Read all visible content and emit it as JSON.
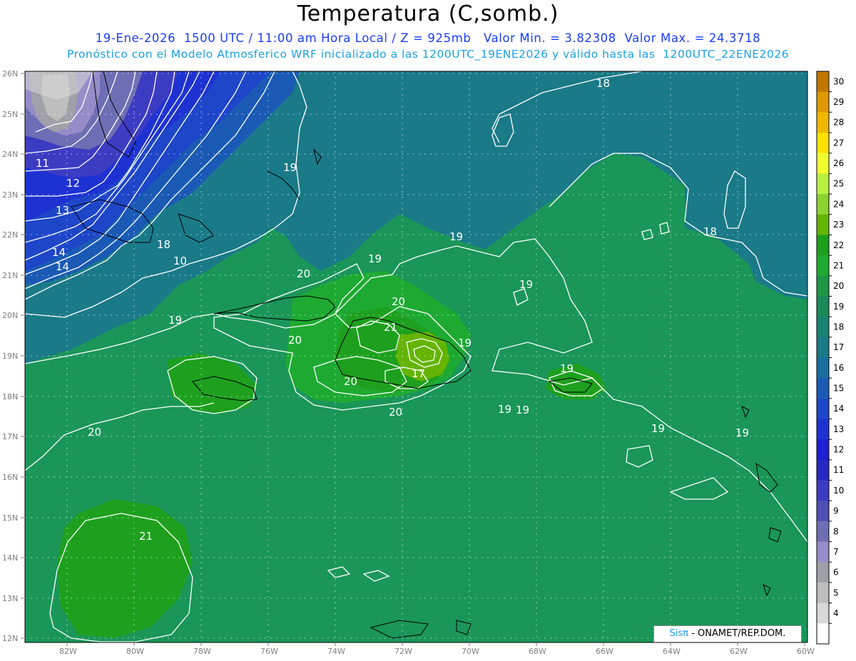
{
  "header": {
    "title": "Temperatura (C,somb.)",
    "line1": "19-Ene-2026  1500 UTC / 11:00 am Hora Local / Z = 925mb   Valor Min. = 3.82308  Valor Max. = 24.3718",
    "line2": "Pronóstico con el Modelo Atmosferico WRF inicializado a las 1200UTC_19ENE2026 y válido hasta las  1200UTC_22ENE2026"
  },
  "lat_labels": [
    "26N",
    "25N",
    "24N",
    "23N",
    "22N",
    "21N",
    "20N",
    "19N",
    "18N",
    "17N",
    "16N",
    "15N",
    "14N",
    "13N",
    "12N"
  ],
  "lon_labels": [
    "82W",
    "80W",
    "78W",
    "76W",
    "74W",
    "72W",
    "70W",
    "68W",
    "66W",
    "64W",
    "62W",
    "60W"
  ],
  "colorbar": {
    "labels": [
      "30",
      "29",
      "28",
      "27",
      "26",
      "25",
      "24",
      "23",
      "22",
      "21",
      "20",
      "19",
      "18",
      "17",
      "16",
      "15",
      "14",
      "13",
      "12",
      "11",
      "10",
      "9",
      "8",
      "7",
      "6",
      "5",
      "4"
    ],
    "colors": [
      "#c07800",
      "#e09800",
      "#f0b800",
      "#ffe000",
      "#f0ff30",
      "#b8f040",
      "#8cd230",
      "#64b400",
      "#1ea01e",
      "#1eaa32",
      "#1e9646",
      "#1a8a5a",
      "#1a8272",
      "#1a7a88",
      "#1a6ea0",
      "#1a5ab4",
      "#1e46c8",
      "#1e32d2",
      "#1e1ed2",
      "#2828c3",
      "#3c3cc3",
      "#5050b4",
      "#6e6eb4",
      "#968cc8",
      "#a0a0a8",
      "#bebebe",
      "#d8d8d8",
      "#ffffff"
    ]
  },
  "contour_labels": [
    "18",
    "18",
    "19",
    "19",
    "19",
    "19",
    "19",
    "19",
    "19",
    "19",
    "19",
    "19",
    "19",
    "20",
    "20",
    "20",
    "20",
    "20",
    "20",
    "21",
    "21",
    "17",
    "18",
    "10",
    "11",
    "12",
    "13",
    "14"
  ],
  "credit": {
    "brand": "Sisπ",
    "text": "- ONAMET/REP.DOM."
  }
}
